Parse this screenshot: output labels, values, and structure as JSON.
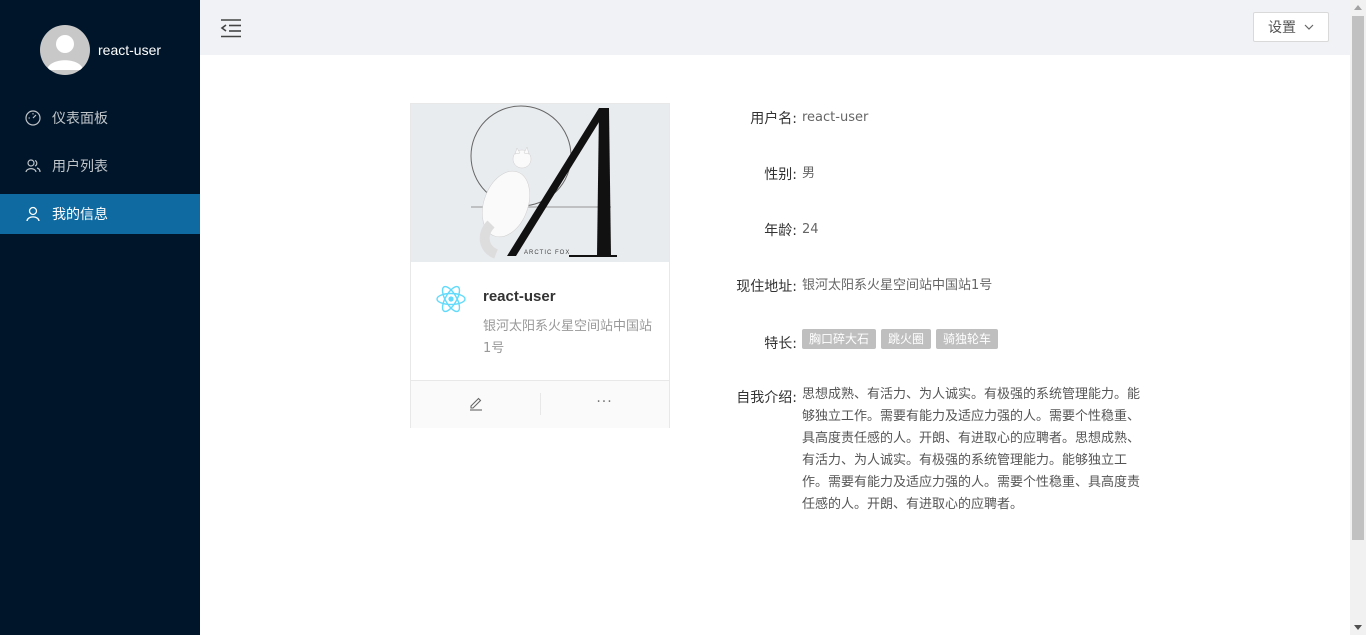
{
  "sidebar": {
    "username": "react-user",
    "menu": [
      {
        "label": "仪表面板",
        "icon": "dashboard-icon"
      },
      {
        "label": "用户列表",
        "icon": "users-icon"
      },
      {
        "label": "我的信息",
        "icon": "user-icon",
        "active": true
      }
    ]
  },
  "header": {
    "settings_label": "设置"
  },
  "card": {
    "cover_caption": "ARCTIC FOX",
    "title": "react-user",
    "description": "银河太阳系火星空间站中国站1号"
  },
  "info": {
    "username_label": "用户名:",
    "username_value": "react-user",
    "gender_label": "性别:",
    "gender_value": "男",
    "age_label": "年龄:",
    "age_value": "24",
    "address_label": "现住地址:",
    "address_value": "银河太阳系火星空间站中国站1号",
    "skills_label": "特长:",
    "skills": [
      "胸口碎大石",
      "跳火圈",
      "骑独轮车"
    ],
    "intro_label": "自我介绍:",
    "intro_value": "思想成熟、有活力、为人诚实。有极强的系统管理能力。能够独立工作。需要有能力及适应力强的人。需要个性稳重、具高度责任感的人。开朗、有进取心的应聘者。思想成熟、有活力、为人诚实。有极强的系统管理能力。能够独立工作。需要有能力及适应力强的人。需要个性稳重、具高度责任感的人。开朗、有进取心的应聘者。"
  },
  "colors": {
    "sidebar_bg": "#001529",
    "active_item": "#0f6aa1",
    "tag_bg": "#bfbfbf"
  }
}
